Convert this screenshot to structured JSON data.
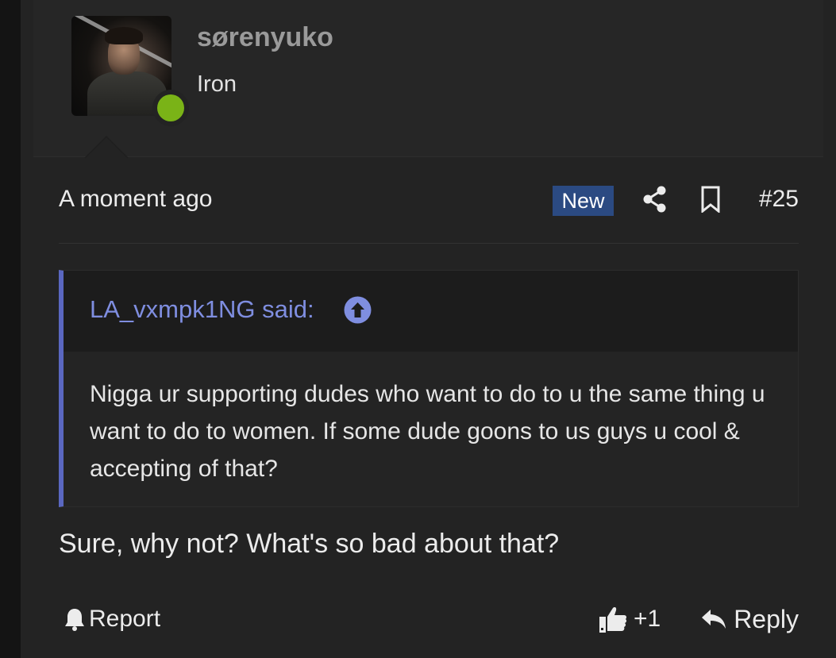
{
  "user": {
    "username": "sørenyuko",
    "title": "Iron",
    "online_color": "#7ab317"
  },
  "meta": {
    "timestamp": "A moment ago",
    "badge": "New",
    "badge_color": "#2b4a82",
    "post_number": "#25",
    "icons": [
      "share-icon",
      "bookmark-icon"
    ]
  },
  "quote": {
    "author_label": "LA_vxmpk1NG said:",
    "text": "Nigga ur supporting dudes who want to do to u the same thing u want to do to women. If some dude goons to us guys u cool & accepting of that?",
    "accent_color": "#5a67c0",
    "icon": "arrow-up-circle-icon"
  },
  "reply": {
    "text": "Sure, why not? What's so bad about that?"
  },
  "footer": {
    "report_label": "Report",
    "like_count": "+1",
    "reply_label": "Reply",
    "icons": [
      "bell-icon",
      "thumbs-up-icon",
      "reply-arrow-icon"
    ]
  }
}
